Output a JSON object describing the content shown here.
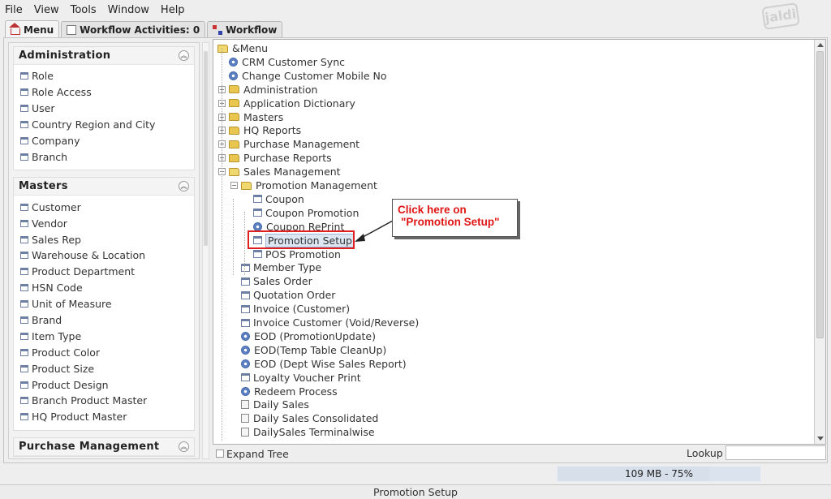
{
  "menubar": {
    "items": [
      "File",
      "View",
      "Tools",
      "Window",
      "Help"
    ]
  },
  "logo": {
    "text": "jaldi"
  },
  "tabs": [
    {
      "label": "Menu",
      "icon": "home-icon"
    },
    {
      "label": "Workflow Activities: 0",
      "icon": "document-icon"
    },
    {
      "label": "Workflow",
      "icon": "workflow-icon"
    }
  ],
  "left_panel": {
    "sections": [
      {
        "title": "Administration",
        "items": [
          "Role",
          "Role Access",
          "User",
          "Country Region and City",
          "Company",
          "Branch"
        ]
      },
      {
        "title": "Masters",
        "items": [
          "Customer",
          "Vendor",
          "Sales Rep",
          "Warehouse & Location",
          "Product Department",
          "HSN Code",
          "Unit of Measure",
          "Brand",
          "Item Type",
          "Product Color",
          "Product Size",
          "Product Design",
          "Branch Product Master",
          "HQ Product Master"
        ]
      },
      {
        "title": "Purchase Management",
        "items": []
      }
    ]
  },
  "tree": {
    "root": "&Menu",
    "nodes": [
      {
        "label": "CRM Customer Sync",
        "type": "process"
      },
      {
        "label": "Change Customer Mobile No",
        "type": "process"
      },
      {
        "label": "Administration",
        "type": "folder"
      },
      {
        "label": "Application Dictionary",
        "type": "folder"
      },
      {
        "label": "Masters",
        "type": "folder"
      },
      {
        "label": "HQ Reports",
        "type": "folder"
      },
      {
        "label": "Purchase Management",
        "type": "folder"
      },
      {
        "label": "Purchase Reports",
        "type": "folder"
      },
      {
        "label": "Sales Management",
        "type": "folder-open"
      },
      {
        "label": "Promotion Management",
        "type": "folder-open"
      },
      {
        "label": "Coupon",
        "type": "window"
      },
      {
        "label": "Coupon Promotion",
        "type": "window"
      },
      {
        "label": "Coupon RePrint",
        "type": "process"
      },
      {
        "label": "Promotion Setup",
        "type": "window",
        "selected": true
      },
      {
        "label": "POS Promotion",
        "type": "window"
      },
      {
        "label": "Member Type",
        "type": "window"
      },
      {
        "label": "Sales Order",
        "type": "window"
      },
      {
        "label": "Quotation Order",
        "type": "window"
      },
      {
        "label": "Invoice (Customer)",
        "type": "window"
      },
      {
        "label": "Invoice Customer (Void/Reverse)",
        "type": "window"
      },
      {
        "label": "EOD (PromotionUpdate)",
        "type": "process"
      },
      {
        "label": "EOD(Temp Table CleanUp)",
        "type": "process"
      },
      {
        "label": "EOD (Dept Wise Sales Report)",
        "type": "process"
      },
      {
        "label": "Loyalty Voucher Print",
        "type": "window"
      },
      {
        "label": "Redeem Process",
        "type": "process"
      },
      {
        "label": "Daily Sales",
        "type": "report"
      },
      {
        "label": "Daily Sales Consolidated",
        "type": "report"
      },
      {
        "label": "DailySales Terminalwise",
        "type": "report"
      }
    ]
  },
  "callout": {
    "line1": "Click here on",
    "line2": "\"Promotion Setup\""
  },
  "bottom": {
    "expand_tree_label": "Expand Tree",
    "lookup_label": "Lookup",
    "lookup_value": ""
  },
  "memory": {
    "text": "109 MB - 75%",
    "percent": 75
  },
  "status": {
    "text": "Promotion Setup"
  }
}
